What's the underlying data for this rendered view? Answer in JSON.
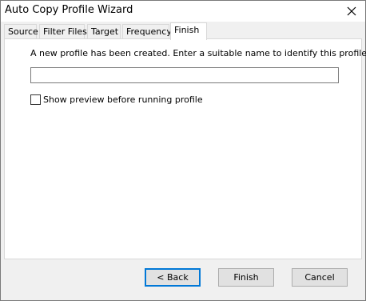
{
  "window": {
    "title": "Auto Copy Profile Wizard",
    "close_icon": "close-icon"
  },
  "tabs": [
    {
      "label": "Source"
    },
    {
      "label": "Filter Files"
    },
    {
      "label": "Target"
    },
    {
      "label": "Frequency"
    },
    {
      "label": "Finish",
      "active": true
    }
  ],
  "finish": {
    "message": "A new profile has been created. Enter a suitable name to identify this profile.",
    "name_value": "",
    "preview_label": "Show preview before running profile",
    "preview_checked": false
  },
  "buttons": {
    "back": "< Back",
    "finish": "Finish",
    "cancel": "Cancel"
  },
  "colors": {
    "accent": "#0078d7",
    "panel_bg": "#ffffff",
    "window_bg": "#f0f0f0"
  }
}
